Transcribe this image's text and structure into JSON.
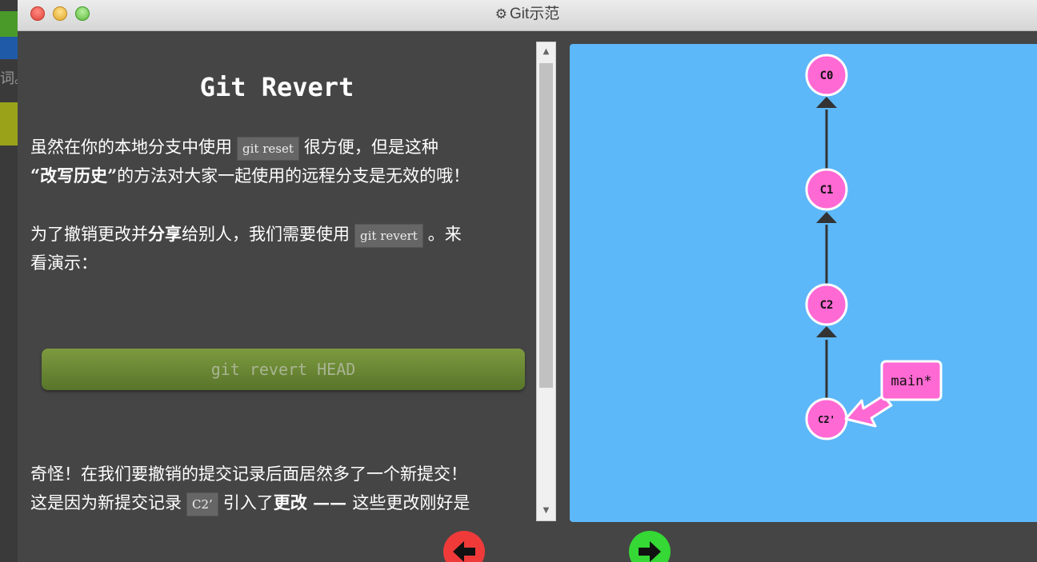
{
  "window": {
    "title": "Git示范",
    "icon": "gear-icon"
  },
  "background_app": {
    "snippet": "词。"
  },
  "lesson": {
    "heading": "Git Revert",
    "p1_a": "虽然在你的本地分支中使用",
    "p1_code": "git reset",
    "p1_b": "很方便，但是这种",
    "p1_line2_a": "“改写历史”",
    "p1_line2_b": "的方法对大家一起使用的远程分支是无效的哦！",
    "p2_a": "为了撤销更改并",
    "p2_bold": "分享",
    "p2_b": "给别人，我们需要使用",
    "p2_code": "git revert",
    "p2_c": "。来",
    "p2_line2": "看演示：",
    "command_button": "git revert HEAD",
    "p3_line1": "奇怪！在我们要撤销的提交记录后面居然多了一个新提交！",
    "p3_a": "这是因为新提交记录",
    "p3_code": "C2’",
    "p3_b": "引入了",
    "p3_bold": "更改",
    "p3_dash": " —— ",
    "p3_c": "这些更改刚好是"
  },
  "graph": {
    "background": "#5cb8f8",
    "commit_color": "#ff69d3",
    "commits": [
      "C0",
      "C1",
      "C2",
      "C2'"
    ],
    "branch_label": "main*"
  },
  "navigation": {
    "back_icon": "arrow-left-icon",
    "forward_icon": "arrow-right-icon",
    "back_color": "#f03a3a",
    "forward_color": "#35d835"
  }
}
